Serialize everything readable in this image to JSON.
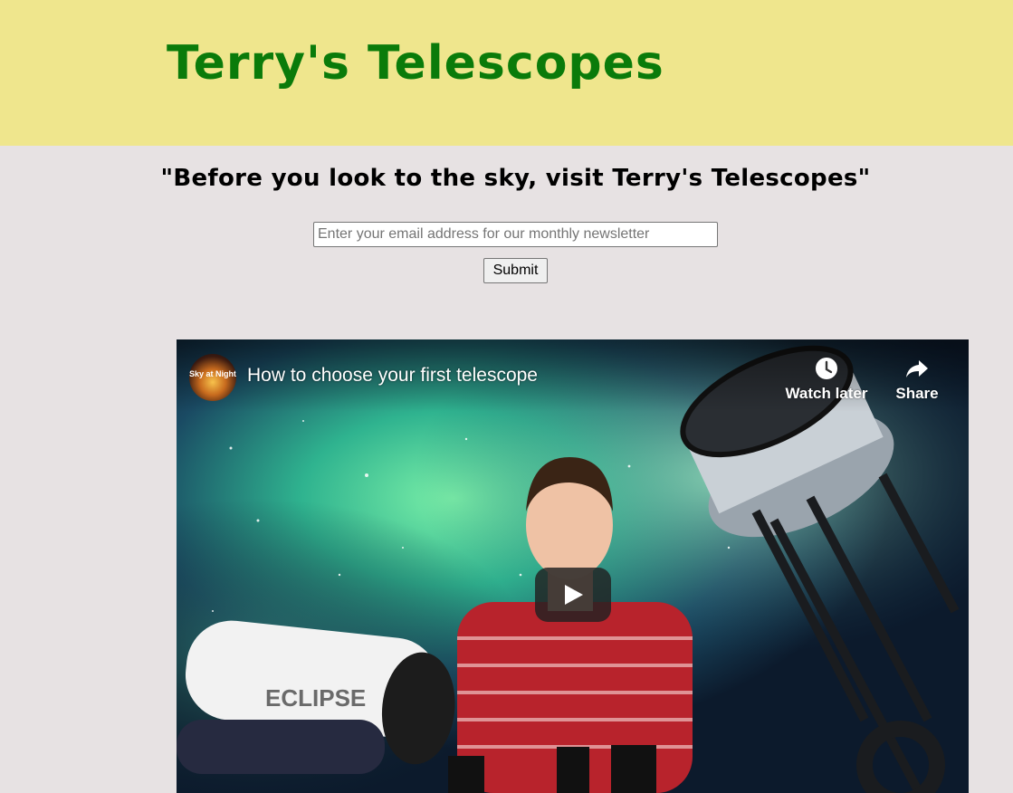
{
  "header": {
    "site_title": "Terry's Telescopes",
    "background_color": "#efe68d",
    "title_color": "#0a7b0a"
  },
  "tagline": "\"Before you look to the sky, visit Terry's Telescopes\"",
  "newsletter": {
    "email_value": "",
    "email_placeholder": "Enter your email address for our monthly newsletter",
    "submit_label": "Submit"
  },
  "video": {
    "channel_logo_text": "Sky at Night",
    "title": "How to choose your first telescope",
    "watch_later_label": "Watch later",
    "share_label": "Share",
    "play_icon": "play-icon",
    "product_label": "ECLIPSE"
  },
  "page_background": "#e7e2e3"
}
